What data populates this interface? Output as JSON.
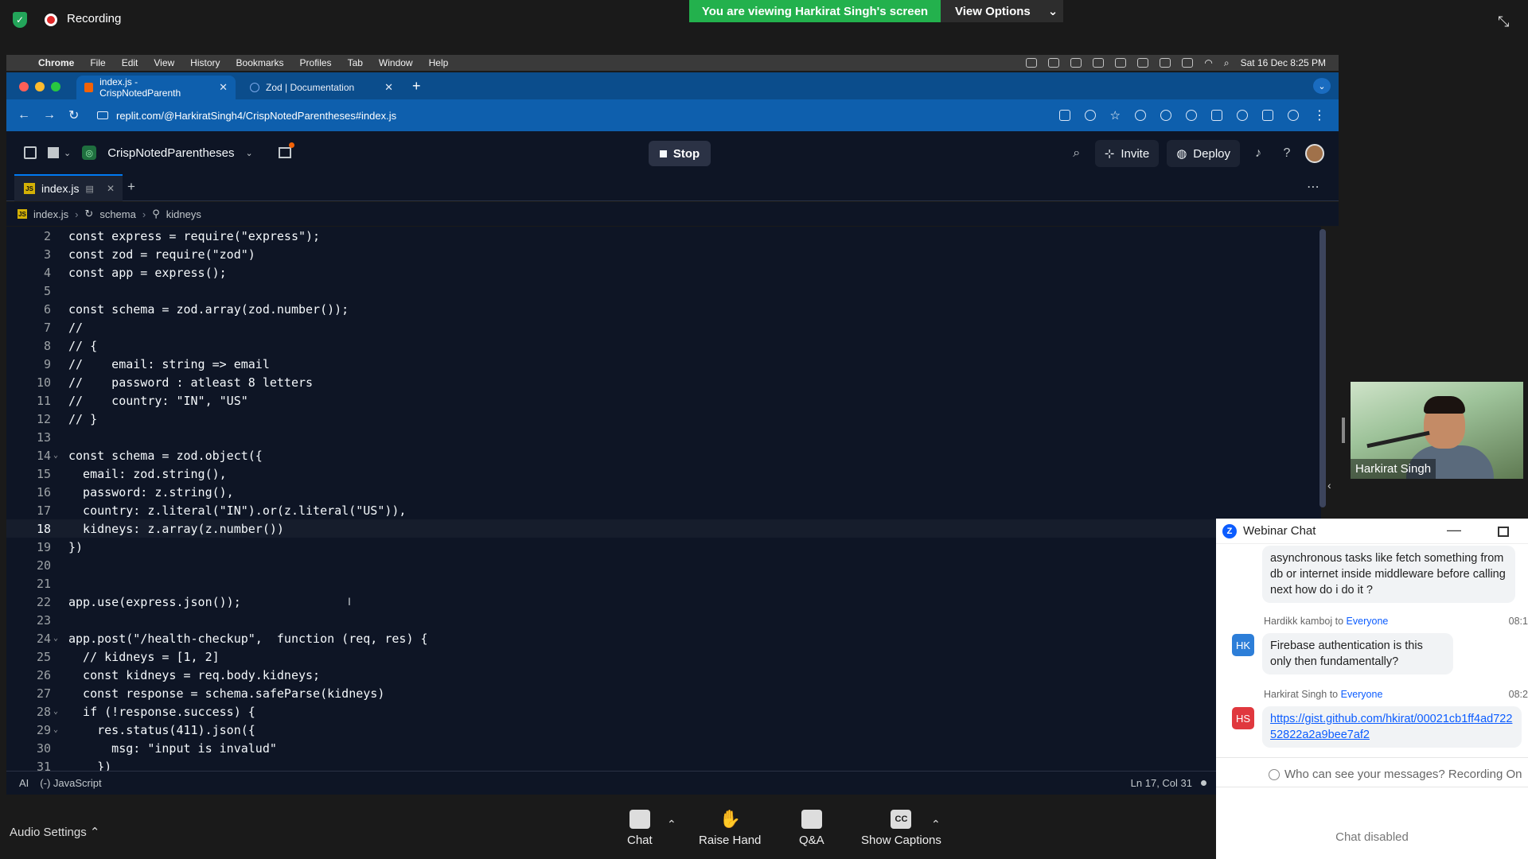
{
  "zoom": {
    "recording": "Recording",
    "viewing_banner": "You are viewing Harkirat Singh's screen",
    "view_options": "View Options",
    "audio_settings": "Audio Settings",
    "toolbar": {
      "chat": "Chat",
      "raise_hand": "Raise Hand",
      "qa": "Q&A",
      "captions": "Show Captions",
      "captions_icon": "CC"
    },
    "participant_name": "Harkirat Singh"
  },
  "macos_menu": {
    "items": [
      "Chrome",
      "File",
      "Edit",
      "View",
      "History",
      "Bookmarks",
      "Profiles",
      "Tab",
      "Window",
      "Help"
    ],
    "clock": "Sat 16 Dec  8:25 PM"
  },
  "browser": {
    "tabs": [
      {
        "title": "index.js - CrispNotedParenth"
      },
      {
        "title": "Zod | Documentation"
      }
    ],
    "url": "replit.com/@HarkiratSingh4/CrispNotedParentheses#index.js"
  },
  "replit": {
    "project_name": "CrispNotedParentheses",
    "stop_label": "Stop",
    "invite_label": "Invite",
    "deploy_label": "Deploy",
    "file_tab": "index.js",
    "breadcrumb": [
      "index.js",
      "schema",
      "kidneys"
    ],
    "status_ai": "AI",
    "status_lang": "(-) JavaScript",
    "cursor_pos": "Ln 17, Col 31",
    "code_lines": [
      {
        "n": "2",
        "t": "const express = require(\"express\");"
      },
      {
        "n": "3",
        "t": "const zod = require(\"zod\")"
      },
      {
        "n": "4",
        "t": "const app = express();"
      },
      {
        "n": "5",
        "t": ""
      },
      {
        "n": "6",
        "t": "const schema = zod.array(zod.number());"
      },
      {
        "n": "7",
        "t": "//"
      },
      {
        "n": "8",
        "t": "// {"
      },
      {
        "n": "9",
        "t": "//    email: string => email"
      },
      {
        "n": "10",
        "t": "//    password : atleast 8 letters"
      },
      {
        "n": "11",
        "t": "//    country: \"IN\", \"US\""
      },
      {
        "n": "12",
        "t": "// }"
      },
      {
        "n": "13",
        "t": ""
      },
      {
        "n": "14",
        "t": "const schema = zod.object({"
      },
      {
        "n": "15",
        "t": "  email: zod.string(),"
      },
      {
        "n": "16",
        "t": "  password: z.string(),"
      },
      {
        "n": "17",
        "t": "  country: z.literal(\"IN\").or(z.literal(\"US\")),"
      },
      {
        "n": "18",
        "t": "  kidneys: z.array(z.number())"
      },
      {
        "n": "19",
        "t": "})"
      },
      {
        "n": "20",
        "t": ""
      },
      {
        "n": "21",
        "t": ""
      },
      {
        "n": "22",
        "t": "app.use(express.json());"
      },
      {
        "n": "23",
        "t": ""
      },
      {
        "n": "24",
        "t": "app.post(\"/health-checkup\",  function (req, res) {"
      },
      {
        "n": "25",
        "t": "  // kidneys = [1, 2]"
      },
      {
        "n": "26",
        "t": "  const kidneys = req.body.kidneys;"
      },
      {
        "n": "27",
        "t": "  const response = schema.safeParse(kidneys)"
      },
      {
        "n": "28",
        "t": "  if (!response.success) {"
      },
      {
        "n": "29",
        "t": "    res.status(411).json({"
      },
      {
        "n": "30",
        "t": "      msg: \"input is invalud\""
      },
      {
        "n": "31",
        "t": "    })"
      }
    ]
  },
  "chat": {
    "title": "Webinar Chat",
    "prev_message": "asynchronous tasks like fetch something from db or internet inside middleware before calling next how do i do it ?",
    "messages": [
      {
        "sender": "Hardikk kamboj",
        "to": "to",
        "audience": "Everyone",
        "time": "08:1",
        "initials": "HK",
        "text": "Firebase authentication is this only then fundamentally?"
      },
      {
        "sender": "Harkirat Singh",
        "to": "to",
        "audience": "Everyone",
        "time": "08:2",
        "initials": "HS",
        "text": "https://gist.github.com/hkirat/00021cb1ff4ad72252822a2a9bee7af2"
      }
    ],
    "who_can_see": "Who can see your messages? Recording On",
    "disabled": "Chat disabled"
  },
  "colors": {
    "zoom_green": "#23b14d",
    "replit_bg": "#0e1525",
    "chrome_blue": "#0e5fad",
    "zoom_blue": "#0b5cff"
  }
}
